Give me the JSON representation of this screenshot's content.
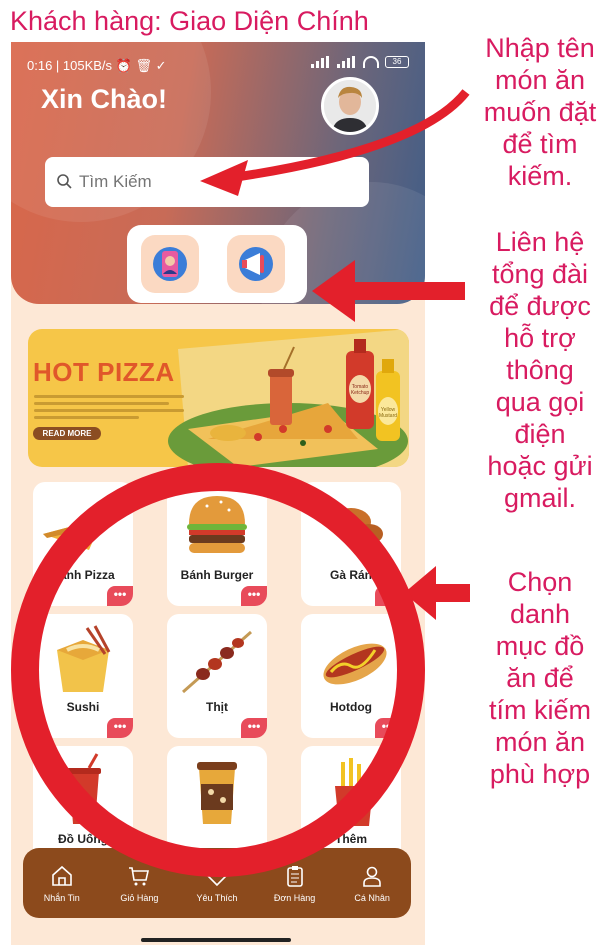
{
  "slide_title": "Khách hàng: Giao Diện Chính",
  "status_bar": {
    "left": "0:16 | 105KB/s",
    "battery": "36"
  },
  "greeting": "Xin Chào!",
  "search": {
    "placeholder": "Tìm Kiếm"
  },
  "banner": {
    "title": "HOT PIZZA",
    "button": "READ MORE",
    "bottle1": "Tomato Ketchup",
    "bottle2": "Yellow Mustard"
  },
  "categories": [
    {
      "label": "Bánh Pizza",
      "more": "•••"
    },
    {
      "label": "Bánh Burger",
      "more": "•••"
    },
    {
      "label": "Gà Rán",
      "more": "•••"
    },
    {
      "label": "Sushi",
      "more": "•••"
    },
    {
      "label": "Thịt",
      "more": "•••"
    },
    {
      "label": "Hotdog",
      "more": "•••"
    },
    {
      "label": "Đồ Uống",
      "more": ""
    },
    {
      "label": "",
      "more": ""
    },
    {
      "label": "Thêm",
      "more": ""
    }
  ],
  "nav": [
    {
      "label": "Nhắn Tin",
      "icon": "home-icon"
    },
    {
      "label": "Giỏ Hàng",
      "icon": "cart-icon"
    },
    {
      "label": "Yêu Thích",
      "icon": "heart-icon"
    },
    {
      "label": "Đơn Hàng",
      "icon": "clipboard-icon"
    },
    {
      "label": "Cá Nhân",
      "icon": "user-icon"
    }
  ],
  "notes": {
    "search_note": [
      "Nhập tên",
      "món ăn",
      "muốn đặt",
      "để tìm",
      "kiếm."
    ],
    "contact_note": [
      "Liên hệ",
      "tổng đài",
      "để được",
      "hỗ trợ",
      "thông",
      "qua gọi",
      "điện",
      "hoặc gửi",
      "gmail."
    ],
    "category_note": [
      "Chọn",
      "danh",
      "mục đồ",
      "ăn để",
      "tím kiếm",
      "món ăn",
      "phù hợp"
    ]
  },
  "colors": {
    "annotation": "#d81b60",
    "arrow": "#e3202b",
    "navbar": "#8c4a1c",
    "more_badge": "#e84b5a"
  }
}
